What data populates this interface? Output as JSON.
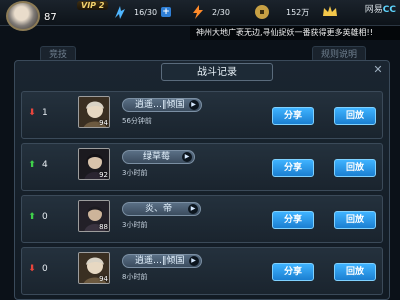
{
  "player": {
    "level": "87",
    "vip": "VIP 2"
  },
  "resources": [
    {
      "icon": "stamina-icon",
      "value": "16/30",
      "has_plus": true
    },
    {
      "icon": "energy-icon",
      "value": "2/30",
      "has_plus": false
    },
    {
      "icon": "coin-icon",
      "value": "152万",
      "has_plus": false
    }
  ],
  "branding": {
    "netease": "网易",
    "cc": "CC"
  },
  "marquee": "神州大地广袤无边,寻仙捉妖一番获得更多英雄相!!",
  "background_tabs": [
    "竞技",
    "规则说明"
  ],
  "dialog": {
    "title": "战斗记录",
    "rows": [
      {
        "trend": "down",
        "rank": "1",
        "name": "逍遥…‖倾国",
        "level": "94",
        "time": "56分钟前",
        "share": "分享",
        "replay": "回放"
      },
      {
        "trend": "up",
        "rank": "4",
        "name": "绿草莓",
        "level": "92",
        "time": "3小时前",
        "share": "分享",
        "replay": "回放"
      },
      {
        "trend": "up",
        "rank": "0",
        "name": "炎、帝",
        "level": "88",
        "time": "3小时前",
        "share": "分享",
        "replay": "回放"
      },
      {
        "trend": "down",
        "rank": "0",
        "name": "逍遥…‖倾国",
        "level": "94",
        "time": "8小时前",
        "share": "分享",
        "replay": "回放"
      }
    ]
  },
  "colors": {
    "button_blue": "#2a98e8",
    "trend_up": "#3fcf4a",
    "trend_down": "#e8453c",
    "vip_gold": "#f3d36e"
  }
}
